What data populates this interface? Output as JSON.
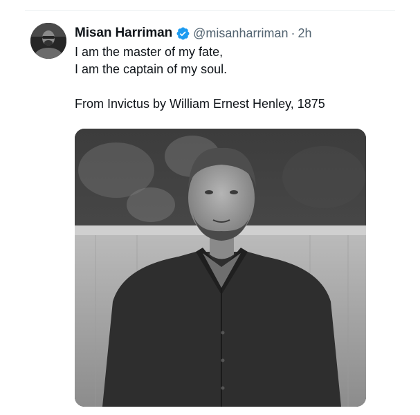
{
  "tweet": {
    "author": {
      "display_name": "Misan Harriman",
      "handle": "@misanharriman",
      "verified": true,
      "avatar_icon": "avatar-photo"
    },
    "separator": "·",
    "timestamp": "2h",
    "text_lines": [
      "I am the master of my fate,",
      "I am the captain of my soul.",
      "",
      "From Invictus by William Ernest Henley, 1875"
    ],
    "media": {
      "kind": "photo",
      "style": "black-and-white portrait"
    }
  },
  "colors": {
    "verified_badge": "#1d9bf0",
    "secondary_text": "#536471",
    "primary_text": "#0f1419"
  }
}
